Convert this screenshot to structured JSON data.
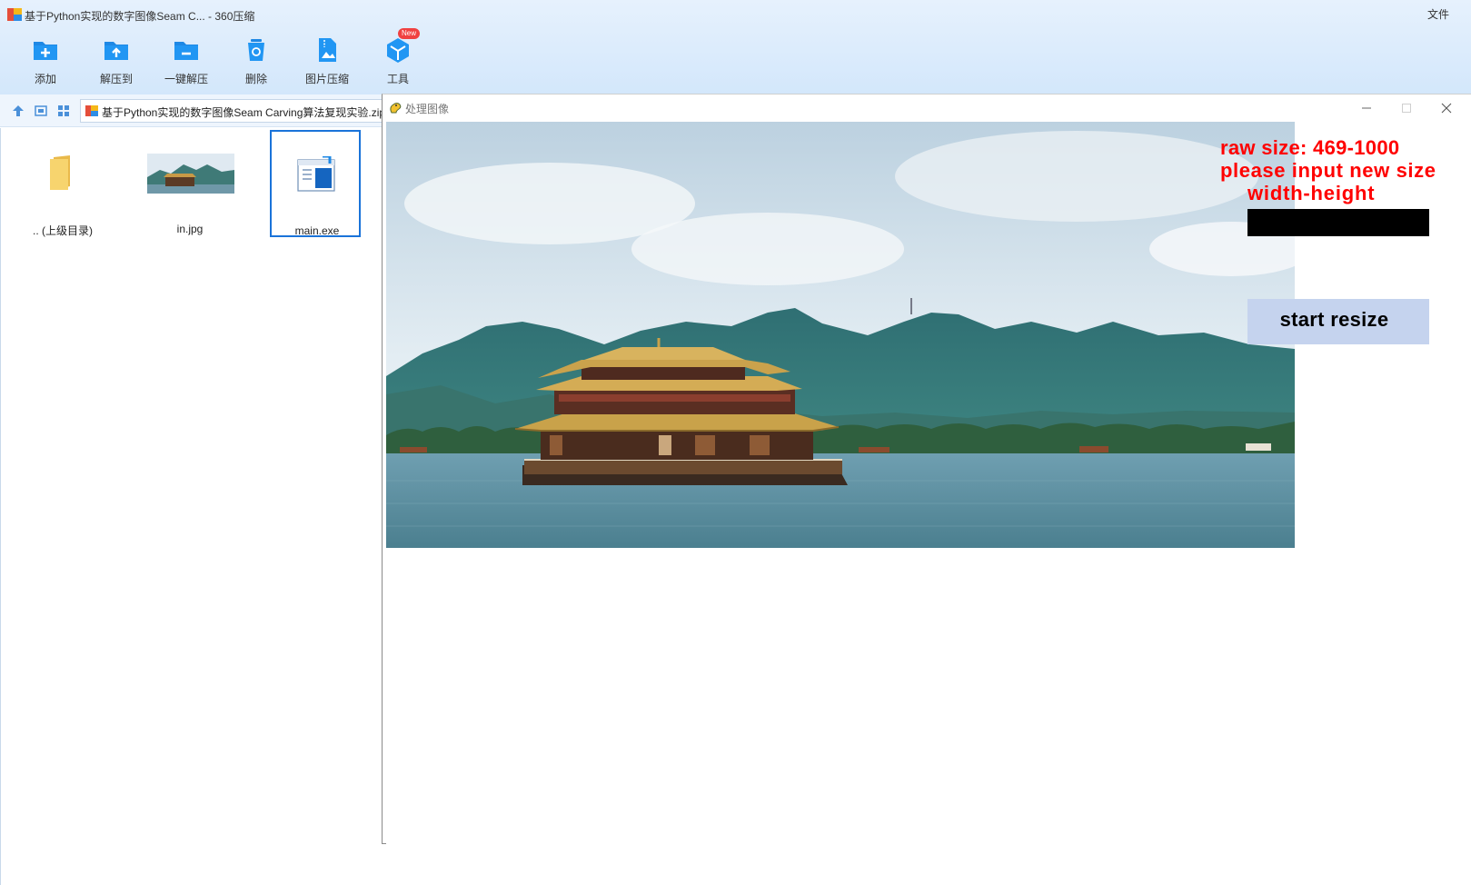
{
  "zip_window": {
    "title": "基于Python实现的数字图像Seam C... - 360压缩",
    "menu_file": "文件",
    "toolbar": [
      {
        "label": "添加",
        "icon": "folder-add-icon"
      },
      {
        "label": "解压到",
        "icon": "folder-extract-icon"
      },
      {
        "label": "一键解压",
        "icon": "folder-unzip-icon"
      },
      {
        "label": "删除",
        "icon": "recycle-bin-icon"
      },
      {
        "label": "图片压缩",
        "icon": "image-compress-icon"
      },
      {
        "label": "工具",
        "icon": "tools-cube-icon",
        "badge": "New"
      }
    ],
    "address": "基于Python实现的数字图像Seam Carving算法复现实验.zip",
    "files": [
      {
        "name": ".. (上级目录)",
        "icon": "folder-icon"
      },
      {
        "name": "in.jpg",
        "icon": "image-thumbnail"
      },
      {
        "name": "main.exe",
        "icon": "exe-icon",
        "selected": true
      }
    ]
  },
  "pygame_window": {
    "title": "处理图像",
    "raw_size_text": "raw size: 469-1000",
    "prompt_line1": "please input new size",
    "prompt_line2": "width-height",
    "input_value": "",
    "start_button": "start resize"
  },
  "colors": {
    "prompt_red": "#ff0000",
    "button_bg": "#c5d3ee",
    "input_bg": "#000000",
    "accent_blue": "#1a73d9"
  }
}
